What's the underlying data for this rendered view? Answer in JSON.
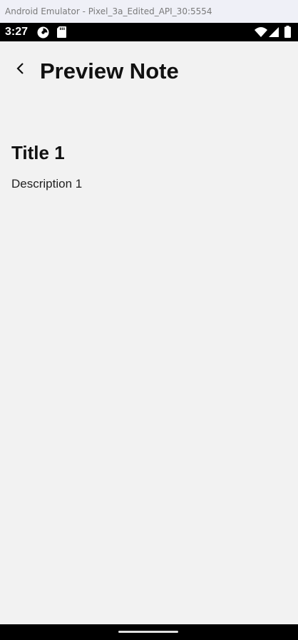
{
  "window": {
    "title": "Android Emulator - Pixel_3a_Edited_API_30:5554"
  },
  "status_bar": {
    "time": "3:27",
    "icons_left": [
      "privacy-indicator-icon",
      "sd-card-icon"
    ],
    "icons_right": [
      "wifi-icon",
      "cellular-signal-icon",
      "battery-icon"
    ]
  },
  "header": {
    "back_icon": "chevron-left-icon",
    "title": "Preview Note"
  },
  "note": {
    "title": "Title 1",
    "description": "Description 1"
  },
  "colors": {
    "background": "#f2f2f2",
    "status_bar": "#000000",
    "text": "#111111"
  }
}
